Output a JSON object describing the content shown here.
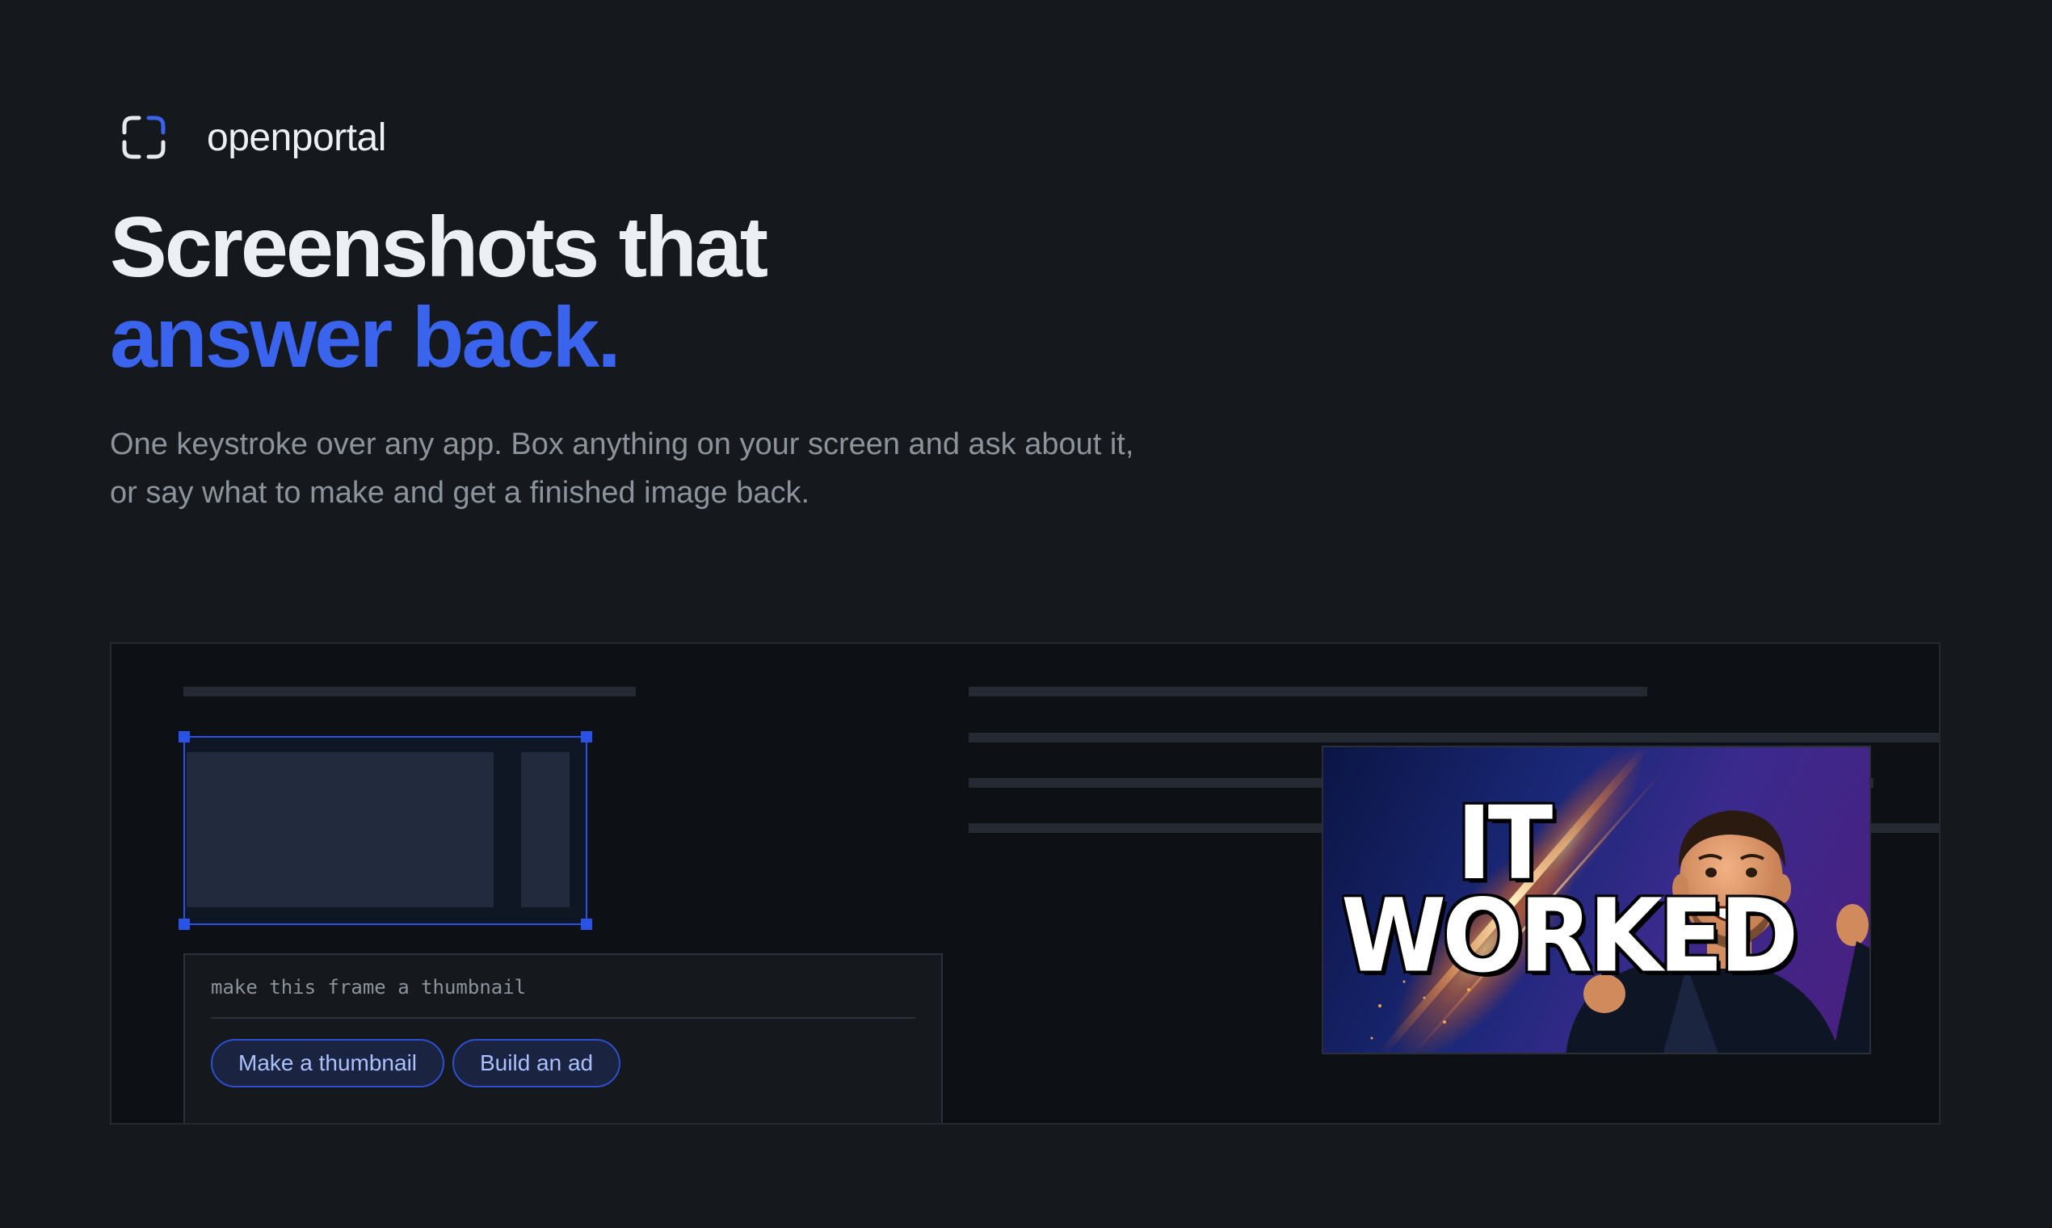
{
  "brand": {
    "name": "openportal",
    "logo_icon": "capture-frame-icon",
    "accent_color": "#3a64ee"
  },
  "hero": {
    "title_line1": "Screenshots that",
    "title_line2": "answer back."
  },
  "subtitle": {
    "line1": "One keystroke over any app. Box anything on your screen and ask about it,",
    "line2": "or say what to make and get a finished image back."
  },
  "demo": {
    "prompt_text": "make this frame a thumbnail",
    "chips": [
      "Make a thumbnail",
      "Build an ad"
    ],
    "thumbnail": {
      "title_line1": "IT",
      "title_line2": "WORKED",
      "subject_icon": "excited-person-illustration"
    }
  }
}
